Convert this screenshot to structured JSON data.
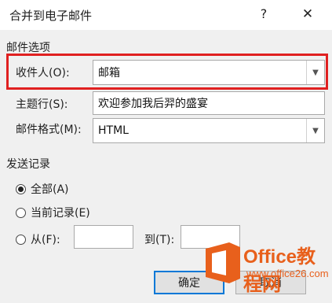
{
  "window": {
    "title": "合并到电子邮件",
    "help": "?",
    "close": "✕"
  },
  "message_options": {
    "section_label": "邮件选项",
    "to_label": "收件人(O):",
    "to_value": "邮箱",
    "subject_label": "主题行(S):",
    "subject_value": "欢迎参加我后羿的盛宴",
    "format_label": "邮件格式(M):",
    "format_value": "HTML"
  },
  "send_records": {
    "section_label": "发送记录",
    "options": [
      {
        "label": "全部(A)",
        "checked": true
      },
      {
        "label": "当前记录(E)",
        "checked": false
      },
      {
        "label": "从(F):",
        "checked": false
      }
    ],
    "to_label": "到(T):"
  },
  "buttons": {
    "ok": "确定",
    "cancel": "取消"
  },
  "watermark": {
    "text1": "Office教程网",
    "text2": "www.office26.com"
  }
}
